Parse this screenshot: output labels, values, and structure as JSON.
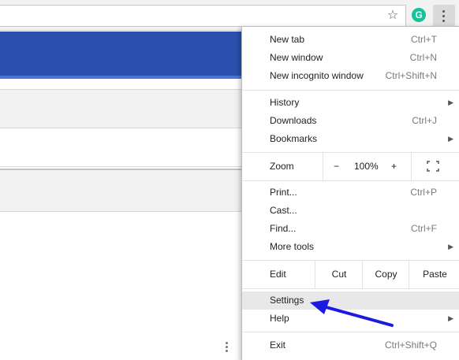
{
  "toolbar": {
    "star_icon": "star-icon",
    "extension_icon_letter": "G",
    "menu_icon": "three-dots-vertical-icon"
  },
  "menu": {
    "new_tab": {
      "label": "New tab",
      "shortcut": "Ctrl+T"
    },
    "new_window": {
      "label": "New window",
      "shortcut": "Ctrl+N"
    },
    "new_incognito": {
      "label": "New incognito window",
      "shortcut": "Ctrl+Shift+N"
    },
    "history": {
      "label": "History"
    },
    "downloads": {
      "label": "Downloads",
      "shortcut": "Ctrl+J"
    },
    "bookmarks": {
      "label": "Bookmarks"
    },
    "zoom": {
      "label": "Zoom",
      "minus": "−",
      "level": "100%",
      "plus": "+"
    },
    "print": {
      "label": "Print...",
      "shortcut": "Ctrl+P"
    },
    "cast": {
      "label": "Cast..."
    },
    "find": {
      "label": "Find...",
      "shortcut": "Ctrl+F"
    },
    "more_tools": {
      "label": "More tools"
    },
    "edit": {
      "label": "Edit",
      "cut": "Cut",
      "copy": "Copy",
      "paste": "Paste"
    },
    "settings": {
      "label": "Settings"
    },
    "help": {
      "label": "Help"
    },
    "exit": {
      "label": "Exit",
      "shortcut": "Ctrl+Shift+Q"
    },
    "submenu_arrow": "▶"
  },
  "colors": {
    "banner": "#2b4fae",
    "annotation_arrow": "#1a1ae0",
    "highlight": "#e8e8e8"
  }
}
